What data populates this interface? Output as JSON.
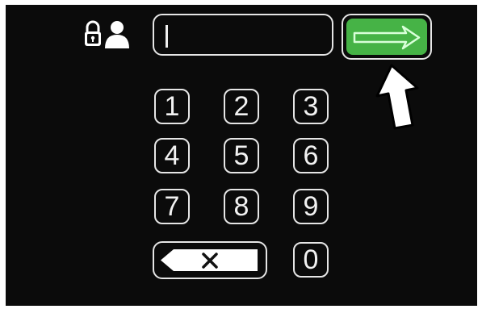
{
  "code_input": {
    "value": ""
  },
  "keypad": {
    "keys": [
      "1",
      "2",
      "3",
      "4",
      "5",
      "6",
      "7",
      "8",
      "9",
      "0"
    ]
  },
  "icons": {
    "lock": "lock-icon",
    "user": "user-icon",
    "enter": "arrow-right-icon",
    "backspace": "backspace-x-icon",
    "pointer": "up-arrow-pointer-icon"
  },
  "colors": {
    "background": "#0b0b0b",
    "outline": "#e6e6e6",
    "enter_fill": "#46b346",
    "text": "#f2f2f2"
  }
}
